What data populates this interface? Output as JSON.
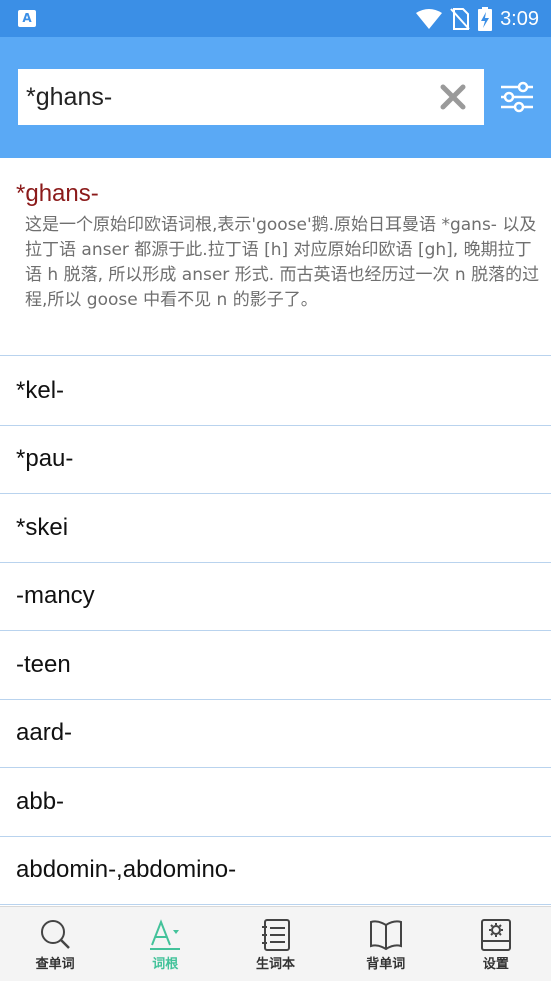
{
  "status_bar": {
    "time": "3:09",
    "app_icon_letter": "A"
  },
  "search": {
    "value": "*ghans-",
    "placeholder": ""
  },
  "featured": {
    "term": "*ghans-",
    "description": "这是一个原始印欧语词根,表示'goose'鹅.原始日耳曼语 *gans- 以及拉丁语 anser 都源于此.拉丁语 [h] 对应原始印欧语 [gh], 晚期拉丁语 h 脱落, 所以形成 anser 形式. 而古英语也经历过一次 n 脱落的过程,所以 goose 中看不见 n 的影子了。"
  },
  "list": [
    {
      "term": "*kel-"
    },
    {
      "term": "*pau-"
    },
    {
      "term": "*skei"
    },
    {
      "term": "-mancy"
    },
    {
      "term": "-teen"
    },
    {
      "term": "aard-"
    },
    {
      "term": "abb-"
    },
    {
      "term": "abdomin-,abdomino-"
    }
  ],
  "nav": {
    "items": [
      {
        "label": "查单词",
        "icon": "search-icon",
        "active": false
      },
      {
        "label": "词根",
        "icon": "root-letter-icon",
        "active": true
      },
      {
        "label": "生词本",
        "icon": "notebook-icon",
        "active": false
      },
      {
        "label": "背单词",
        "icon": "book-icon",
        "active": false
      },
      {
        "label": "设置",
        "icon": "settings-icon",
        "active": false
      }
    ]
  },
  "colors": {
    "status_bar": "#3b8fe6",
    "header": "#5aa9f5",
    "term_highlight": "#8b1a1a",
    "active_tab": "#43c29a",
    "divider": "#b9d3ee"
  }
}
